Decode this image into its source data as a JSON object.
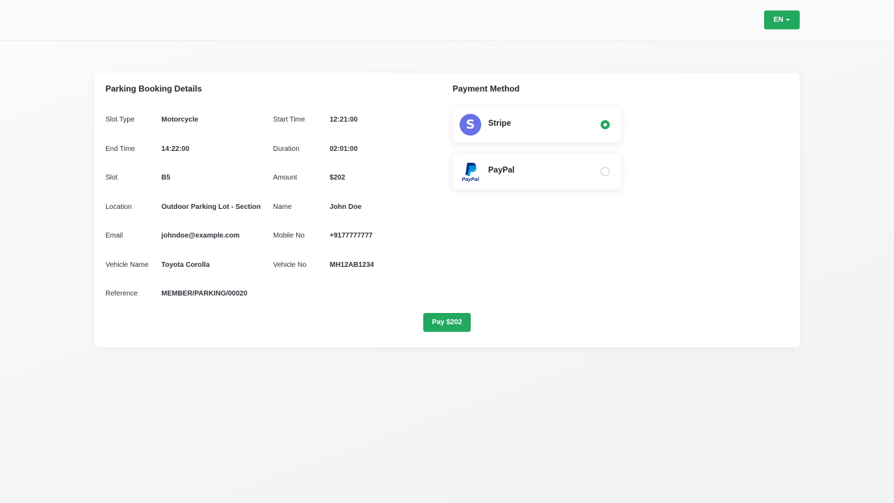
{
  "header": {
    "language": "EN"
  },
  "booking": {
    "title": "Parking Booking Details",
    "rows": [
      [
        {
          "label": "Slot Type",
          "value": "Motorcycle"
        },
        {
          "label": "Start Time",
          "value": "12:21:00"
        }
      ],
      [
        {
          "label": "End Time",
          "value": "14:22:00"
        },
        {
          "label": "Duration",
          "value": "02:01:00"
        }
      ],
      [
        {
          "label": "Slot",
          "value": "B5"
        },
        {
          "label": "Amount",
          "value": "$202"
        }
      ],
      [
        {
          "label": "Location",
          "value": "Outdoor Parking Lot - Section C"
        },
        {
          "label": "Name",
          "value": "John Doe"
        }
      ],
      [
        {
          "label": "Email",
          "value": "johndoe@example.com"
        },
        {
          "label": "Mobile No",
          "value": "+9177777777"
        }
      ],
      [
        {
          "label": "Vehicle Name",
          "value": "Toyota Corolla"
        },
        {
          "label": "Vehicle No",
          "value": "MH12AB1234"
        }
      ],
      [
        {
          "label": "Reference",
          "value": "MEMBER/PARKING/00020"
        }
      ]
    ]
  },
  "payment": {
    "title": "Payment Method",
    "methods": [
      {
        "name": "Stripe",
        "logo": "S",
        "icon": "stripe-logo-icon",
        "selected": true
      },
      {
        "name": "PayPal",
        "logo_text": "PayPal",
        "icon": "paypal-logo-icon",
        "selected": false
      }
    ],
    "pay_button": "Pay $202"
  },
  "colors": {
    "accent": "#23a85f",
    "stripe": "#6772e5",
    "paypal_dark": "#003087",
    "paypal_light": "#009cde"
  }
}
